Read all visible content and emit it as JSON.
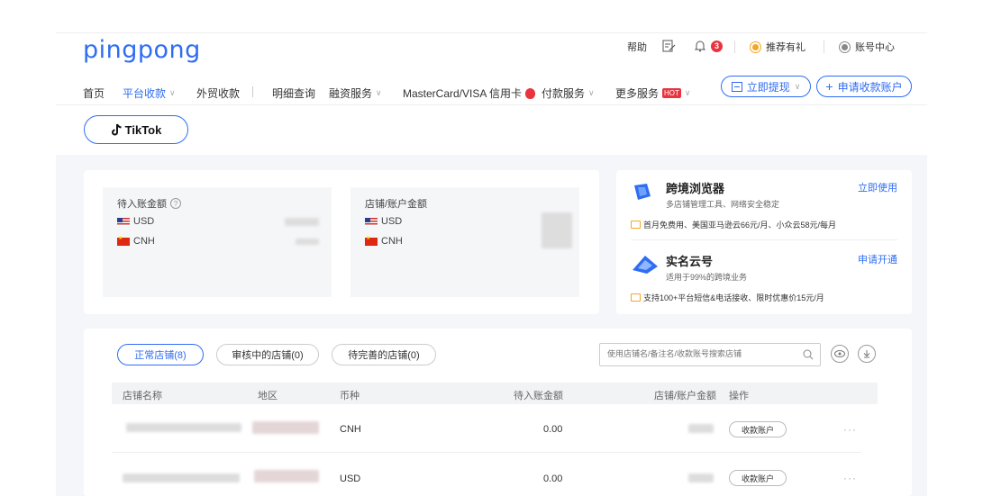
{
  "logo": "pingpong",
  "utility": {
    "help": "帮助",
    "notification_count": "3",
    "referral": "推荐有礼",
    "account": "账号中心"
  },
  "nav": {
    "home": "首页",
    "platform": "平台收款",
    "trade": "外贸收款",
    "details": "明细查询",
    "finance": "融资服务",
    "card": "MasterCard/VISA 信用卡",
    "payment": "付款服务",
    "more": "更多服务",
    "hot_badge": "HOT"
  },
  "actions": {
    "withdraw": "立即提现",
    "apply": "申请收款账户"
  },
  "platform_tab": "TikTok",
  "balances": {
    "pending": {
      "title": "待入账金额",
      "currencies": [
        "USD",
        "CNH"
      ]
    },
    "store": {
      "title": "店铺/账户金额",
      "currencies": [
        "USD",
        "CNH"
      ]
    }
  },
  "services": [
    {
      "title": "跨境浏览器",
      "subtitle": "多店铺管理工具、网络安全稳定",
      "link": "立即使用",
      "promo": "首月免费用、美国亚马逊云66元/月、小众云58元/每月"
    },
    {
      "title": "实名云号",
      "subtitle": "适用于99%的跨境业务",
      "link": "申请开通",
      "promo": "支持100+平台短信&电话接收、限时优惠价15元/月"
    }
  ],
  "store_tabs": [
    "正常店铺(8)",
    "审核中的店铺(0)",
    "待完善的店铺(0)"
  ],
  "search": {
    "placeholder": "使用店铺名/备注名/收款账号搜索店铺"
  },
  "table": {
    "columns": [
      "店铺名称",
      "地区",
      "币种",
      "待入账金额",
      "店铺/账户金额",
      "操作"
    ],
    "rows": [
      {
        "currency": "CNH",
        "pending": "0.00",
        "action": "收款账户"
      },
      {
        "currency": "USD",
        "pending": "0.00",
        "action": "收款账户"
      }
    ],
    "more": "···"
  },
  "colors": {
    "brand": "#2f6df2",
    "alert": "#e8343f",
    "referral": "#f5a623"
  }
}
